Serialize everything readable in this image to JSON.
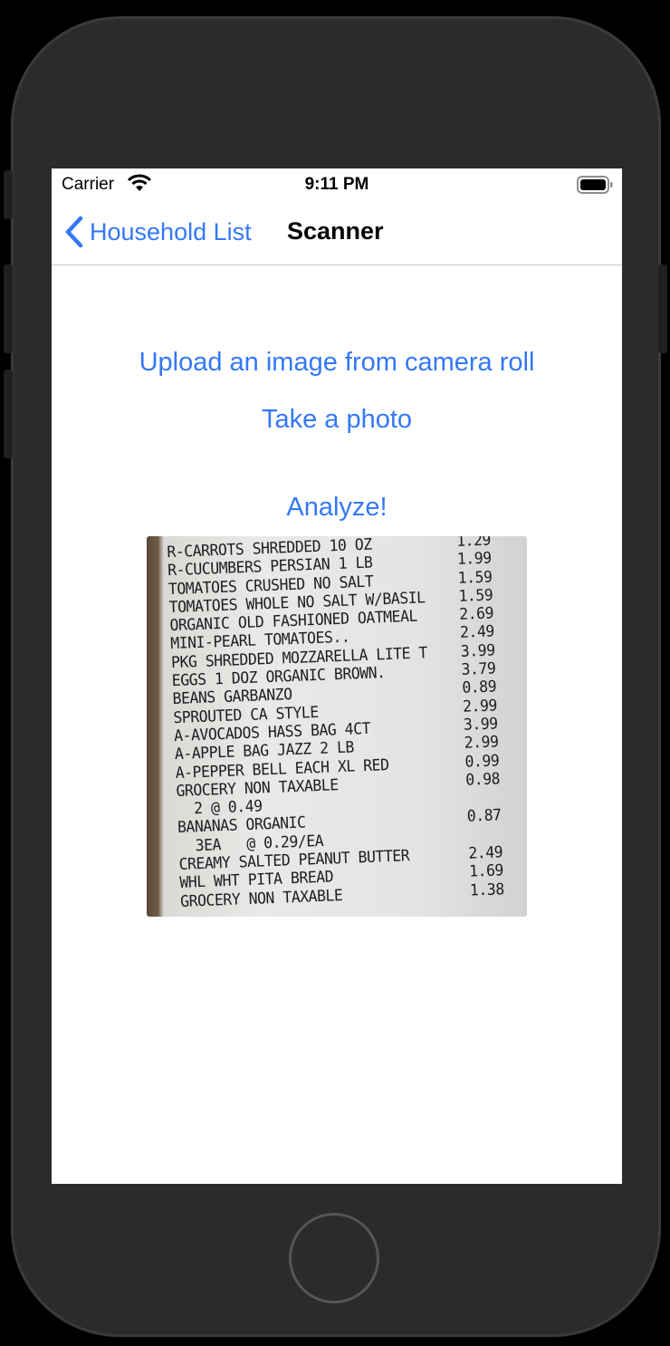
{
  "status_bar": {
    "carrier": "Carrier",
    "time": "9:11 PM",
    "icons": [
      "wifi-icon",
      "battery-icon"
    ]
  },
  "nav": {
    "back_label": "Household List",
    "title": "Scanner",
    "back_icon": "chevron-left-icon"
  },
  "actions": {
    "upload_label": "Upload an image from camera roll",
    "photo_label": "Take a photo",
    "analyze_label": "Analyze!"
  },
  "receipt": {
    "lines": [
      {
        "name": "R-CARROTS SHREDDED 10 OZ",
        "price": "1.29"
      },
      {
        "name": "R-CUCUMBERS PERSIAN 1 LB",
        "price": "1.99"
      },
      {
        "name": "TOMATOES CRUSHED NO SALT",
        "price": "1.59"
      },
      {
        "name": "TOMATOES WHOLE NO SALT W/BASIL",
        "price": "1.59"
      },
      {
        "name": "ORGANIC OLD FASHIONED OATMEAL",
        "price": "2.69"
      },
      {
        "name": "MINI-PEARL TOMATOES..",
        "price": "2.49"
      },
      {
        "name": "PKG SHREDDED MOZZARELLA LITE T",
        "price": "3.99"
      },
      {
        "name": "EGGS 1 DOZ ORGANIC BROWN.",
        "price": "3.79"
      },
      {
        "name": "BEANS GARBANZO",
        "price": "0.89"
      },
      {
        "name": "SPROUTED CA STYLE",
        "price": "2.99"
      },
      {
        "name": "A-AVOCADOS HASS BAG 4CT",
        "price": "3.99"
      },
      {
        "name": "A-APPLE BAG JAZZ 2 LB",
        "price": "2.99"
      },
      {
        "name": "A-PEPPER BELL EACH XL RED",
        "price": "0.99"
      },
      {
        "name": "GROCERY NON TAXABLE",
        "price": "0.98"
      },
      {
        "name": "  2 @ 0.49",
        "price": ""
      },
      {
        "name": "BANANAS ORGANIC",
        "price": "0.87"
      },
      {
        "name": "  3EA   @ 0.29/EA",
        "price": ""
      },
      {
        "name": "CREAMY SALTED PEANUT BUTTER",
        "price": "2.49"
      },
      {
        "name": "WHL WHT PITA BREAD",
        "price": "1.69"
      },
      {
        "name": "GROCERY NON TAXABLE",
        "price": "1.38"
      }
    ]
  },
  "colors": {
    "accent": "#3478f6",
    "device_body": "#2b2b2b",
    "screen_bg": "#ffffff"
  }
}
